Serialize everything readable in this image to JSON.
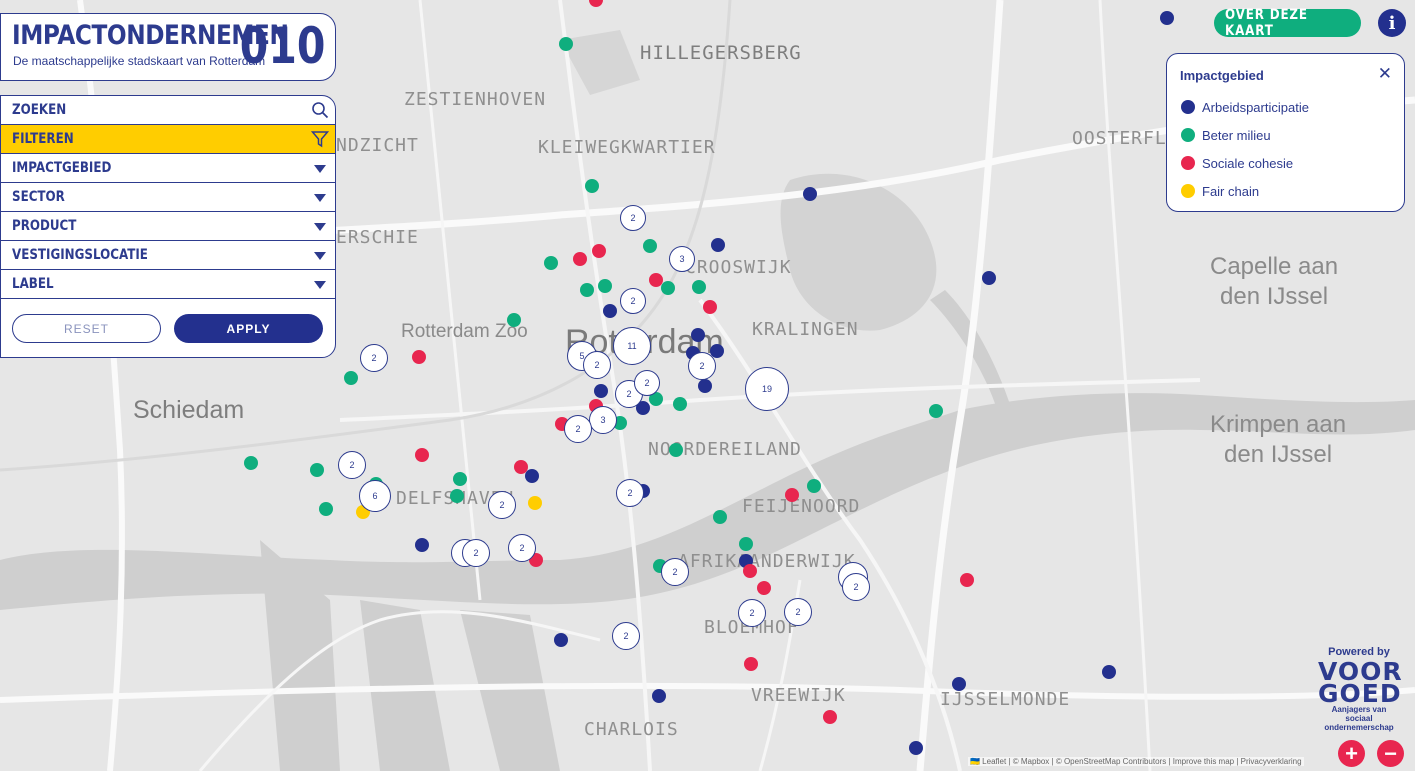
{
  "header": {
    "title": "IMPACTONDERNEMEN",
    "number": "010",
    "subtitle": "De maatschappelijke stadskaart van Rotterdam"
  },
  "filters": {
    "search_label": "ZOEKEN",
    "filter_label": "FILTEREN",
    "dropdowns": [
      "IMPACTGEBIED",
      "SECTOR",
      "PRODUCT",
      "VESTIGINGSLOCATIE",
      "LABEL"
    ],
    "reset_label": "RESET",
    "apply_label": "APPLY"
  },
  "top_right": {
    "about_label": "OVER DEZE KAART",
    "info_label": "i"
  },
  "legend": {
    "title": "Impactgebied",
    "close": "✕",
    "items": [
      {
        "label": "Arbeidsparticipatie",
        "color": "#23308e"
      },
      {
        "label": "Beter milieu",
        "color": "#0fae7e"
      },
      {
        "label": "Sociale cohesie",
        "color": "#e8264f"
      },
      {
        "label": "Fair chain",
        "color": "#ffcd00"
      }
    ]
  },
  "place_labels": {
    "hillegersberg": "HILLEGERSBERG",
    "zestienhoven": "ZESTIENHOVEN",
    "kleiwegkwartier": "KLEIWEGKWARTIER",
    "oosterflank": "OOSTERFLA",
    "overschie": "ERSCHIE",
    "ndzicht": "NDZICHT",
    "crooswijk": "CROOSWIJK",
    "kralingen": "KRALINGEN",
    "rotterdam_zoo": "Rotterdam Zoo",
    "rotterdam": "Rotterdam",
    "schiedam": "Schiedam",
    "noordereiland": "NOORDEREILAND",
    "delfshaven": "DELFSHAVEN",
    "feijenoord": "FEIJENOORD",
    "afrikaanderwijk": "AFRIKAANDERWIJK",
    "bloemhof": "BLOEMHOF",
    "vreewijk": "VREEWIJK",
    "charlois": "CHARLOIS",
    "ijsselmonde": "IJSSELMONDE",
    "capelle_1": "Capelle aan",
    "capelle_2": "den IJssel",
    "krimpen_1": "Krimpen aan",
    "krimpen_2": "den IJssel"
  },
  "markers": [
    {
      "category": "Arbeidsparticipatie",
      "count": 20
    },
    {
      "category": "Beter milieu",
      "count": 31
    },
    {
      "category": "Sociale cohesie",
      "count": 20
    },
    {
      "category": "Fair chain",
      "count": 2
    }
  ],
  "clusters": [
    "2",
    "3",
    "2",
    "11",
    "5",
    "2",
    "2",
    "2",
    "2",
    "3",
    "2",
    "19",
    "2",
    "2",
    "6",
    "2",
    "2",
    "2",
    "2",
    "2",
    "2",
    "2",
    "2",
    "2"
  ],
  "branding": {
    "powered_by": "Powered by",
    "logo_top": "VOOR",
    "logo_bottom": "GOED",
    "tagline": "Aanjagers van sociaal ondernemerschap"
  },
  "attribution": "🇺🇦 Leaflet | © Mapbox | © OpenStreetMap Contributors | Improve this map | Privacyverklaring",
  "zoom": {
    "in": "+",
    "out": "−"
  }
}
